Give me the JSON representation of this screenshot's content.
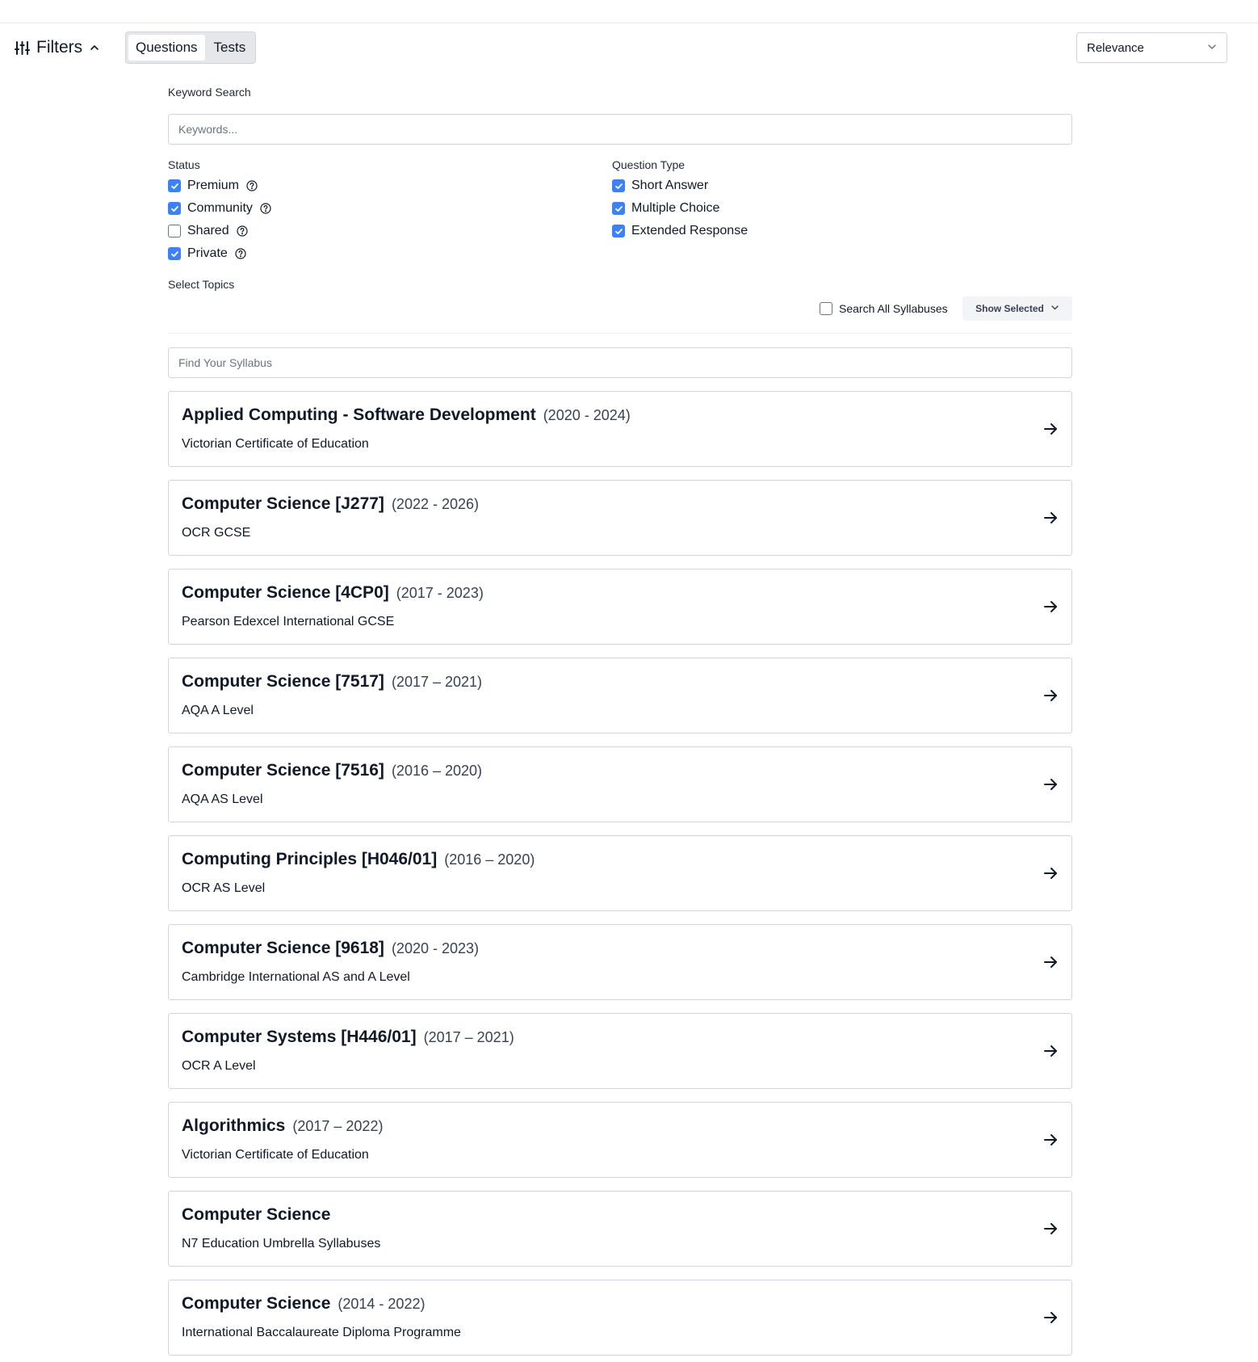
{
  "header": {
    "filters_label": "Filters",
    "tabs": [
      {
        "label": "Questions",
        "active": true
      },
      {
        "label": "Tests",
        "active": false
      }
    ],
    "sort": {
      "value": "Relevance"
    }
  },
  "keyword": {
    "label": "Keyword Search",
    "placeholder": "Keywords..."
  },
  "status": {
    "label": "Status",
    "options": [
      {
        "label": "Premium",
        "checked": true
      },
      {
        "label": "Community",
        "checked": true
      },
      {
        "label": "Shared",
        "checked": false
      },
      {
        "label": "Private",
        "checked": true
      }
    ]
  },
  "question_type": {
    "label": "Question Type",
    "options": [
      {
        "label": "Short Answer",
        "checked": true
      },
      {
        "label": "Multiple Choice",
        "checked": true
      },
      {
        "label": "Extended Response",
        "checked": true
      }
    ]
  },
  "topics": {
    "label": "Select Topics",
    "search_all_label": "Search All Syllabuses",
    "search_all_checked": false,
    "show_selected_label": "Show Selected",
    "syllabus_placeholder": "Find Your Syllabus"
  },
  "syllabuses": [
    {
      "title": "Applied Computing - Software Development",
      "years": "(2020 - 2024)",
      "board": "Victorian Certificate of Education"
    },
    {
      "title": "Computer Science [J277]",
      "years": "(2022 - 2026)",
      "board": "OCR GCSE"
    },
    {
      "title": "Computer Science [4CP0]",
      "years": "(2017 - 2023)",
      "board": "Pearson Edexcel International GCSE"
    },
    {
      "title": "Computer Science [7517]",
      "years": "(2017 – 2021)",
      "board": "AQA A Level"
    },
    {
      "title": "Computer Science [7516]",
      "years": "(2016 – 2020)",
      "board": "AQA AS Level"
    },
    {
      "title": "Computing Principles [H046/01]",
      "years": "(2016 – 2020)",
      "board": "OCR AS Level"
    },
    {
      "title": "Computer Science [9618]",
      "years": "(2020 - 2023)",
      "board": "Cambridge International AS and A Level"
    },
    {
      "title": "Computer Systems [H446/01]",
      "years": "(2017 – 2021)",
      "board": "OCR A Level"
    },
    {
      "title": "Algorithmics",
      "years": "(2017 – 2022)",
      "board": "Victorian Certificate of Education"
    },
    {
      "title": "Computer Science",
      "years": "",
      "board": "N7 Education Umbrella Syllabuses"
    },
    {
      "title": "Computer Science",
      "years": "(2014 - 2022)",
      "board": "International Baccalaureate Diploma Programme"
    }
  ],
  "colors": {
    "accent": "#3b82f6",
    "border": "#d1d5db",
    "text": "#111827"
  }
}
